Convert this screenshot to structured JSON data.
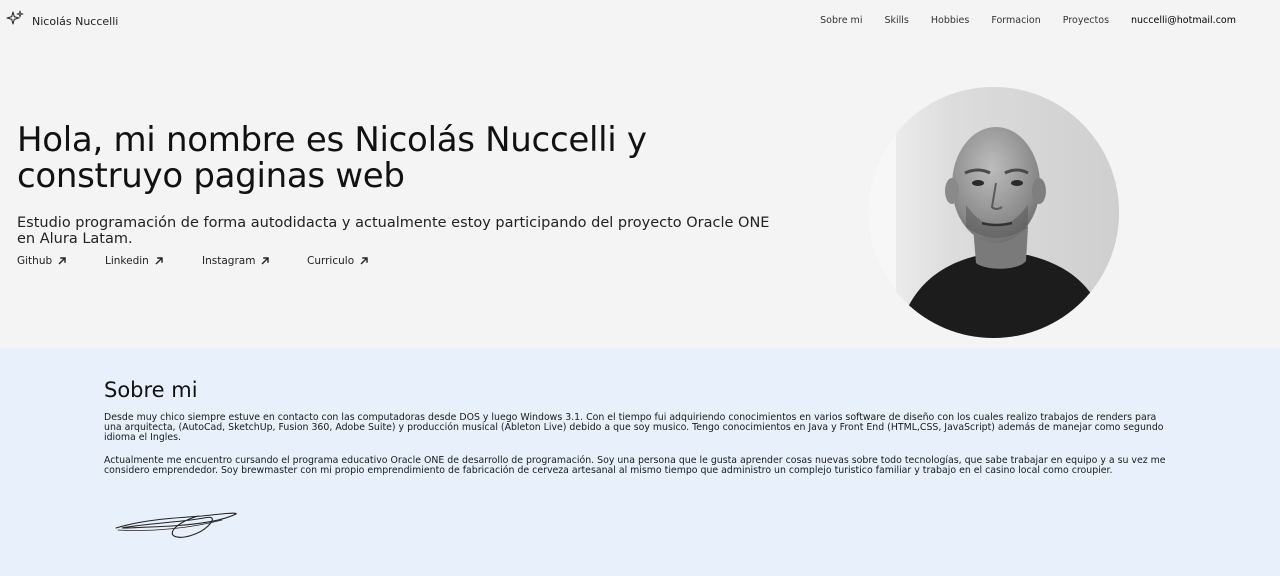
{
  "header": {
    "brand_name": "Nicolás Nuccelli",
    "nav": [
      {
        "label": "Sobre mi"
      },
      {
        "label": "Skills"
      },
      {
        "label": "Hobbies"
      },
      {
        "label": "Formacion"
      },
      {
        "label": "Proyectos"
      }
    ],
    "email": "nuccelli@hotmail.com"
  },
  "hero": {
    "title": "Hola, mi nombre es Nicolás Nuccelli y construyo paginas web",
    "subtitle": "Estudio programación de forma autodidacta y actualmente estoy participando del proyecto Oracle ONE en Alura Latam.",
    "links": [
      {
        "label": "Github",
        "icon": "arrow-up-right-icon"
      },
      {
        "label": "Linkedin",
        "icon": "arrow-up-right-icon"
      },
      {
        "label": "Instagram",
        "icon": "arrow-up-right-icon"
      },
      {
        "label": "Curriculo",
        "icon": "arrow-up-right-icon"
      }
    ]
  },
  "about": {
    "title": "Sobre mi",
    "paragraph1": "Desde muy chico siempre estuve en contacto con las computadoras desde DOS y luego Windows 3.1. Con el tiempo fui adquiriendo conocimientos en varios software de diseño con los cuales realizo trabajos de renders para una arquitecta, (AutoCad, SketchUp, Fusion 360, Adobe Suite) y producción musical (Ableton Live) debido a que soy musico. Tengo conocimientos en Java y Front End (HTML,CSS, JavaScript) además de manejar como segundo idioma el Ingles.",
    "paragraph2": "Actualmente me encuentro cursando el programa educativo Oracle ONE de desarrollo de programación. Soy una persona que le gusta aprender cosas nuevas sobre todo tecnologías, que sabe trabajar en equipo y a su vez me considero emprendedor. Soy brewmaster con mi propio emprendimiento de fabricación de cerveza artesanal al mismo tiempo que administro un complejo turistico familiar y trabajo en el casino local como croupier."
  },
  "colors": {
    "page_bg": "#f4f4f4",
    "about_bg": "#e8f0fb",
    "text": "#1a1a1a"
  }
}
